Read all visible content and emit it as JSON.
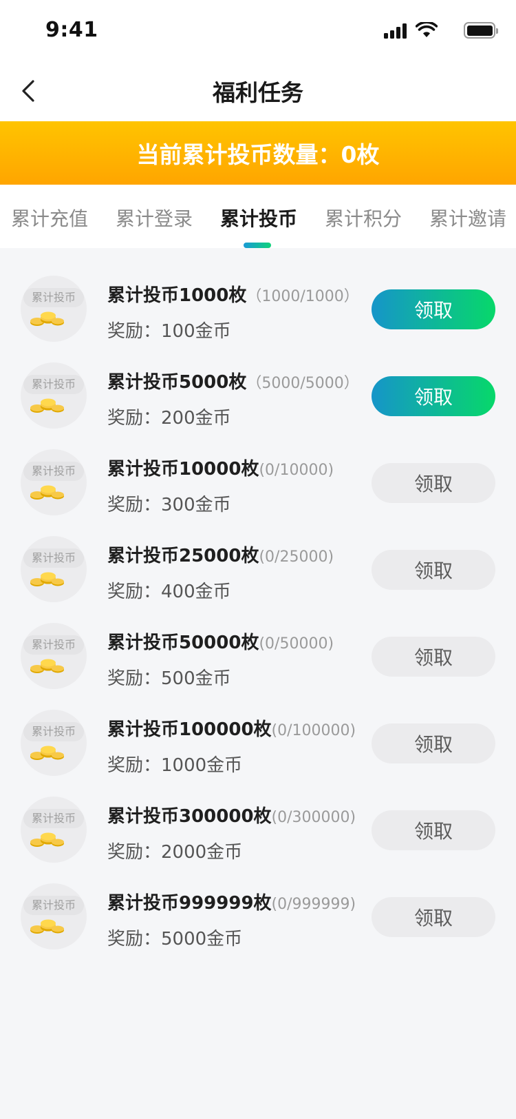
{
  "status": {
    "time": "9:41"
  },
  "nav": {
    "title": "福利任务"
  },
  "banner": {
    "text": "当前累计投币数量：0枚"
  },
  "tabs": [
    {
      "label": "累计充值",
      "active": false
    },
    {
      "label": "累计登录",
      "active": false
    },
    {
      "label": "累计投币",
      "active": true
    },
    {
      "label": "累计积分",
      "active": false
    },
    {
      "label": "累计邀请",
      "active": false
    }
  ],
  "tasks": [
    {
      "title": "累计投币1000枚",
      "progress": "（1000/1000）",
      "reward": "奖励：100金币",
      "thumb_label": "累计投币",
      "button": "领取",
      "enabled": true
    },
    {
      "title": "累计投币5000枚",
      "progress": "（5000/5000）",
      "reward": "奖励：200金币",
      "thumb_label": "累计投币",
      "button": "领取",
      "enabled": true
    },
    {
      "title": "累计投币10000枚",
      "progress": "(0/10000)",
      "reward": "奖励：300金币",
      "thumb_label": "累计投币",
      "button": "领取",
      "enabled": false
    },
    {
      "title": "累计投币25000枚",
      "progress": "(0/25000)",
      "reward": "奖励：400金币",
      "thumb_label": "累计投币",
      "button": "领取",
      "enabled": false
    },
    {
      "title": "累计投币50000枚",
      "progress": "(0/50000)",
      "reward": "奖励：500金币",
      "thumb_label": "累计投币",
      "button": "领取",
      "enabled": false
    },
    {
      "title": "累计投币100000枚",
      "progress": "(0/100000)",
      "reward": "奖励：1000金币",
      "thumb_label": "累计投币",
      "button": "领取",
      "enabled": false
    },
    {
      "title": "累计投币300000枚",
      "progress": "(0/300000)",
      "reward": "奖励：2000金币",
      "thumb_label": "累计投币",
      "button": "领取",
      "enabled": false
    },
    {
      "title": "累计投币999999枚",
      "progress": "(0/999999)",
      "reward": "奖励：5000金币",
      "thumb_label": "累计投币",
      "button": "领取",
      "enabled": false
    }
  ],
  "colors": {
    "banner_top": "#ffc400",
    "banner_bottom": "#ffa500",
    "button_start": "#1695c9",
    "button_end": "#07d86a",
    "button_disabled": "#ebebed",
    "coin": "#f5c518"
  }
}
